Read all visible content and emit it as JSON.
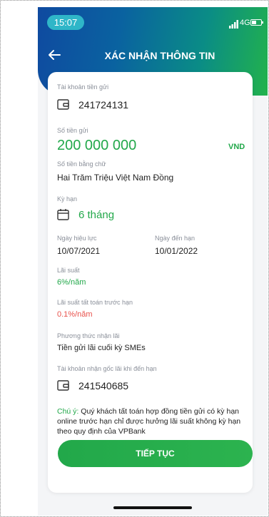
{
  "status_bar": {
    "time": "15:07",
    "network": "4G"
  },
  "header": {
    "title": "XÁC NHẬN THÔNG TIN"
  },
  "form": {
    "source_account_label": "Tài khoản tiền gửi",
    "source_account": "241724131",
    "amount_label": "Số tiền gửi",
    "amount": "200 000 000",
    "currency": "VND",
    "amount_words_label": "Số tiền bằng chữ",
    "amount_words": "Hai Trăm Triệu Việt Nam Đồng",
    "term_label": "Kỳ hạn",
    "term": "6 tháng",
    "effective_date_label": "Ngày hiệu lực",
    "effective_date": "10/07/2021",
    "maturity_date_label": "Ngày đến hạn",
    "maturity_date": "10/01/2022",
    "interest_rate_label": "Lãi suất",
    "interest_rate": "6%/năm",
    "early_rate_label": "Lãi suất tất toán trước hạn",
    "early_rate": "0.1%/năm",
    "interest_method_label": "Phương thức nhận lãi",
    "interest_method": "Tiền gửi lãi cuối kỳ SMEs",
    "maturity_account_label": "Tài khoản nhận gốc lãi khi đến hạn",
    "maturity_account": "241540685"
  },
  "note": {
    "prefix": "Chú ý:",
    "text": " Quý khách tất toán hợp đồng tiền gửi có kỳ hạn online trước hạn chỉ được hưởng lãi suất không kỳ hạn theo quy định của VPBank"
  },
  "actions": {
    "continue_label": "TIẾP TỤC"
  },
  "icons": {
    "back": "arrow-left-icon",
    "wallet": "wallet-icon",
    "calendar": "calendar-icon",
    "signal": "signal-icon",
    "battery": "battery-icon"
  },
  "colors": {
    "accent_green": "#22a84a",
    "header_blue": "#0f4aa0",
    "warning_red": "#e8504a",
    "time_pill": "#2fb6c8"
  }
}
